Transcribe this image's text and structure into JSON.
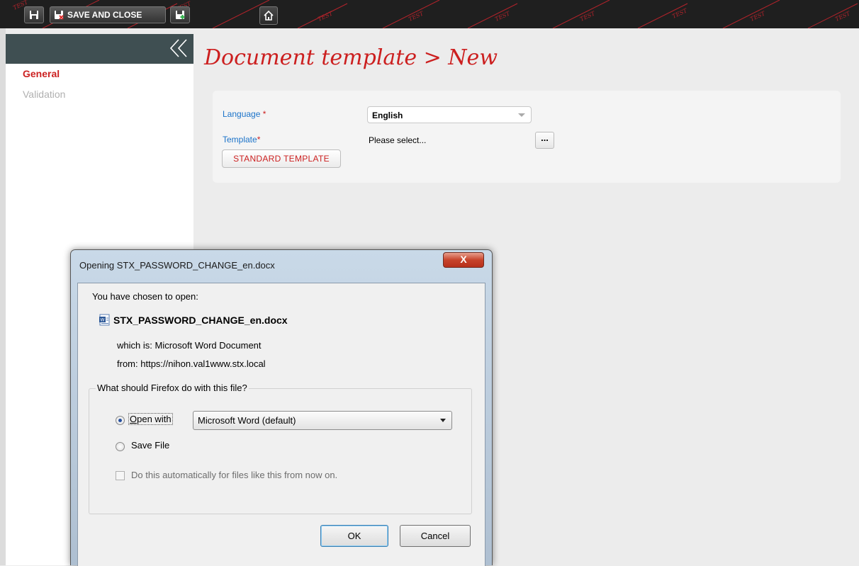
{
  "toolbar": {
    "save_and_close_label": "SAVE AND CLOSE",
    "watermark_text": "TEST"
  },
  "sidebar": {
    "items": [
      {
        "label": "General",
        "active": true
      },
      {
        "label": "Validation",
        "active": false
      }
    ]
  },
  "page": {
    "title": "Document template > New"
  },
  "form": {
    "language_label": "Language",
    "language_value": "English",
    "template_label": "Template",
    "template_value": "Please select...",
    "browse_label": "...",
    "required_marker": "*",
    "standard_template_button": "STANDARD TEMPLATE"
  },
  "dialog": {
    "title": "Opening STX_PASSWORD_CHANGE_en.docx",
    "close_label": "X",
    "intro": "You have chosen to open:",
    "filename": "STX_PASSWORD_CHANGE_en.docx",
    "which_is_label": "which is:",
    "which_is_value": "Microsoft Word Document",
    "from_label": "from:",
    "from_value": "https://nihon.val1www.stx.local",
    "question": "What should Firefox do with this file?",
    "open_with_label": "Open with",
    "open_with_app": "Microsoft Word (default)",
    "save_file_label": "Save File",
    "auto_label": "Do this automatically for files like this from now on.",
    "ok_label": "OK",
    "cancel_label": "Cancel",
    "selected_option": "open_with"
  },
  "colors": {
    "accent_red": "#cc1f1f",
    "link_blue": "#1b73c9",
    "toolbar_bg": "#1f1f1f",
    "collapse_bar": "#3f4f52"
  }
}
